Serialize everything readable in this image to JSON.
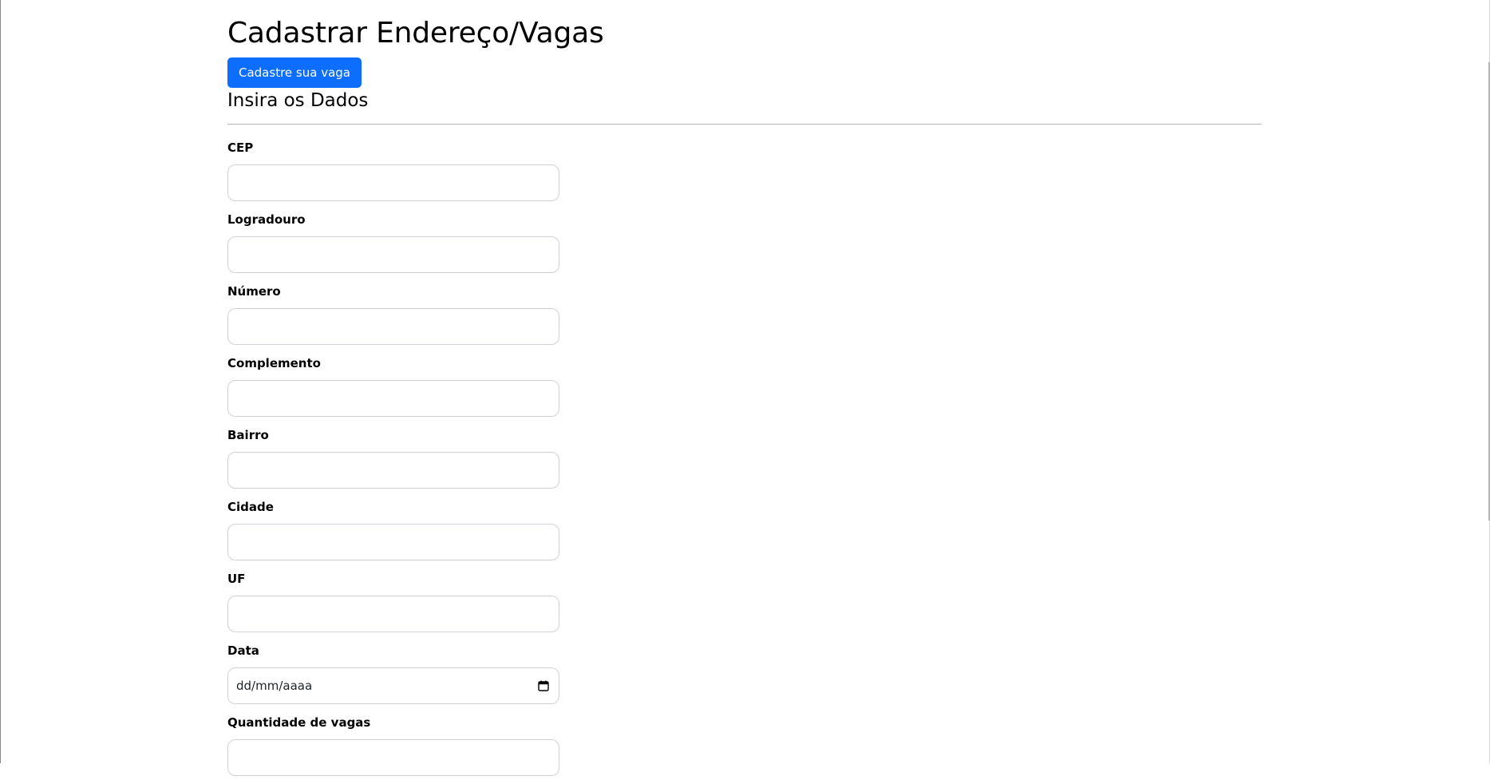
{
  "page": {
    "title": "Cadastrar Endereço/Vagas",
    "register_button_label": "Cadastre sua vaga",
    "section_title": "Insira os Dados"
  },
  "form": {
    "fields": [
      {
        "label": "CEP",
        "value": ""
      },
      {
        "label": "Logradouro",
        "value": ""
      },
      {
        "label": "Número",
        "value": ""
      },
      {
        "label": "Complemento",
        "value": ""
      },
      {
        "label": "Bairro",
        "value": ""
      },
      {
        "label": "Cidade",
        "value": ""
      },
      {
        "label": "UF",
        "value": ""
      },
      {
        "label": "Data",
        "placeholder": "dd/mm/aaaa",
        "icon": "calendar-icon"
      },
      {
        "label": "Quantidade de vagas",
        "value": ""
      }
    ]
  },
  "colors": {
    "primary_button": "#0d6efd",
    "input_border": "#cfd3d7",
    "divider": "#b5b5b5"
  }
}
